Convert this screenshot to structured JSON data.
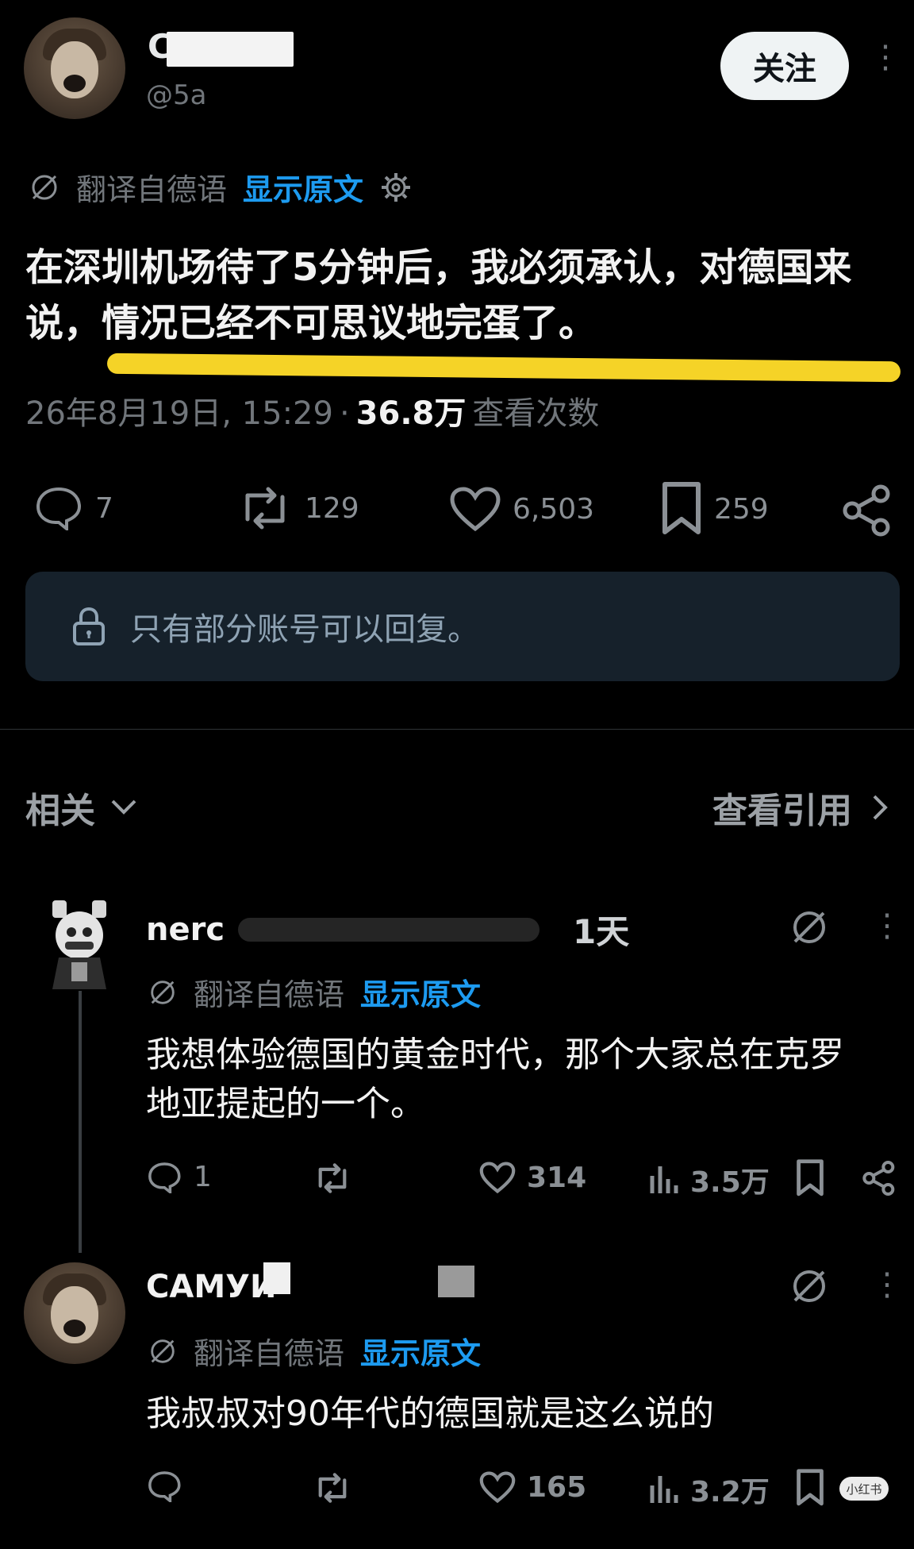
{
  "post": {
    "author_initial": "C",
    "handle": "@5a",
    "follow_label": "关注",
    "translate": {
      "label": "翻译自德语",
      "show_original": "显示原文"
    },
    "text": "在深圳机场待了5分钟后，我必须承认，对德国来说，情况已经不可思议地完蛋了。",
    "meta": {
      "date": "26年8月19日, 15:29",
      "separator": "·",
      "views_count": "36.8万",
      "views_label": "查看次数"
    },
    "actions": {
      "replies": "7",
      "reposts": "129",
      "likes": "6,503",
      "bookmarks": "259"
    },
    "reply_restriction": "只有部分账号可以回复。"
  },
  "section": {
    "related_label": "相关",
    "quotes_label": "查看引用"
  },
  "comments": [
    {
      "name": "nerc",
      "time": "1天",
      "translate_label": "翻译自德语",
      "show_original": "显示原文",
      "text_line1": "我想体验德国的黄金时代，那个大家总在克罗",
      "text_line2": "地亚提起的一个。",
      "replies": "1",
      "likes": "314",
      "views": "3.5万"
    },
    {
      "name": "САМУИ",
      "translate_label": "翻译自德语",
      "show_original": "显示原文",
      "text": "我叔叔对90年代的德国就是这么说的",
      "likes": "165",
      "views": "3.2万"
    }
  ],
  "watermark": "小红书",
  "colors": {
    "background": "#000000",
    "accent_blue": "#1d9bf0",
    "highlight_yellow": "#f5d327",
    "muted": "#71767b"
  }
}
